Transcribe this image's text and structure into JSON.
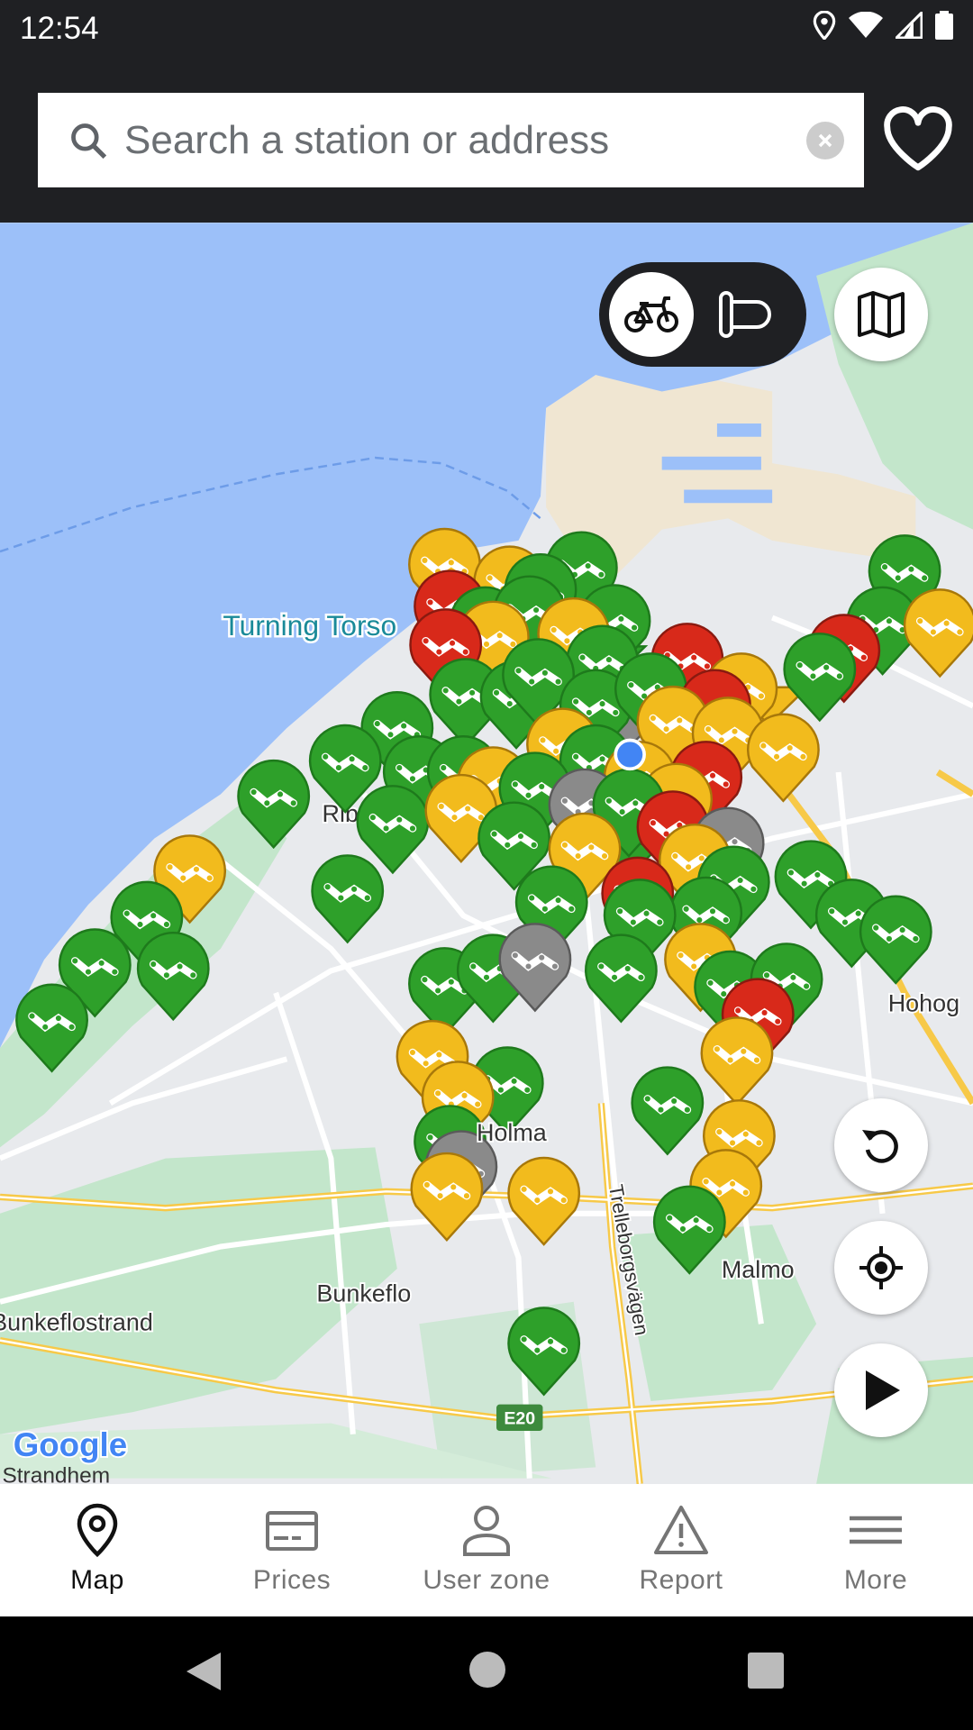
{
  "status_bar": {
    "time": "12:54",
    "icons": [
      "location-icon",
      "wifi-icon",
      "signal-icon",
      "battery-icon"
    ]
  },
  "search": {
    "placeholder": "Search a station or address",
    "value": ""
  },
  "header": {
    "favorites_icon": "heart-icon"
  },
  "mode_toggle": {
    "options": [
      "bike",
      "bike-rack"
    ],
    "selected": "bike"
  },
  "map": {
    "labels": {
      "turning_torso": "Turning Torso",
      "ribersborg": "Rib",
      "holma": "Holma",
      "bunkeflo": "Bunkeflo",
      "bunkeflostrand": "Bunkeflostrand",
      "malmo": "Malmo",
      "hohog": "Hohog",
      "trelleborgsvagen": "Trelleborgsvägen",
      "e20": "E20",
      "strandhem": "Strandhem",
      "google": "Google"
    },
    "status_colors": {
      "green": "#2ea02a",
      "yellow": "#f2bb1d",
      "red": "#d8291a",
      "gray": "#8a8a8a"
    },
    "markers": [
      "yellow",
      "yellow",
      "green",
      "green",
      "red",
      "green",
      "green",
      "green",
      "yellow",
      "yellow",
      "red",
      "red",
      "green",
      "green",
      "green",
      "yellow",
      "red",
      "green",
      "green",
      "green",
      "green",
      "green",
      "green",
      "yellow",
      "red",
      "yellow",
      "yellow",
      "yellow",
      "green",
      "green",
      "green",
      "green",
      "yellow",
      "yellow",
      "green",
      "yellow",
      "red",
      "yellow",
      "green",
      "green",
      "yellow",
      "green",
      "gray",
      "green",
      "green",
      "yellow",
      "red",
      "gray",
      "yellow",
      "yellow",
      "green",
      "green",
      "red",
      "green",
      "green",
      "green",
      "green",
      "green",
      "green",
      "green",
      "green",
      "green",
      "green",
      "green",
      "green",
      "gray",
      "green",
      "yellow",
      "green",
      "green",
      "red",
      "yellow",
      "yellow",
      "green",
      "yellow",
      "green",
      "yellow",
      "green",
      "gray",
      "yellow",
      "yellow",
      "yellow",
      "green",
      "green"
    ],
    "clusters": [
      "green",
      "yellow",
      "yellow",
      "gray",
      "green"
    ]
  },
  "map_controls": {
    "layers": "map-layers-icon",
    "refresh": "refresh-icon",
    "locate": "my-location-icon",
    "play": "play-icon"
  },
  "bottom_nav": {
    "items": [
      {
        "label": "Map",
        "icon": "map-pin-icon",
        "active": true
      },
      {
        "label": "Prices",
        "icon": "card-icon",
        "active": false
      },
      {
        "label": "User zone",
        "icon": "user-icon",
        "active": false
      },
      {
        "label": "Report",
        "icon": "warning-icon",
        "active": false
      },
      {
        "label": "More",
        "icon": "menu-icon",
        "active": false
      }
    ]
  }
}
